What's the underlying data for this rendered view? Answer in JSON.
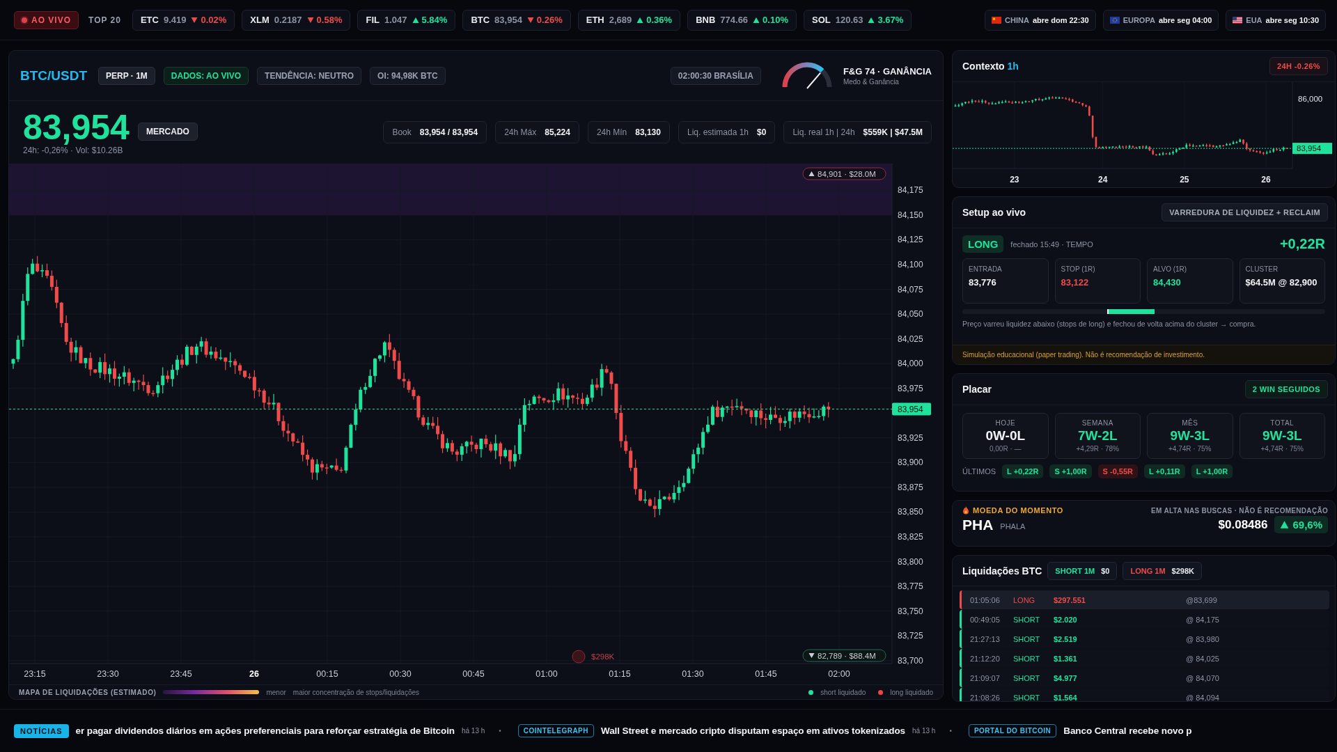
{
  "top_bar": {
    "live_badge": "AO VIVO",
    "list_label": "TOP 20",
    "tickers": [
      {
        "symbol": "ETC",
        "price": "9.419",
        "change": "0.02%",
        "kind": "down"
      },
      {
        "symbol": "XLM",
        "price": "0.2187",
        "change": "0.58%",
        "kind": "down"
      },
      {
        "symbol": "FIL",
        "price": "1.047",
        "change": "5.84%",
        "kind": "up"
      },
      {
        "symbol": "BTC",
        "price": "83,954",
        "change": "0.26%",
        "kind": "down"
      },
      {
        "symbol": "ETH",
        "price": "2,689",
        "change": "0.36%",
        "kind": "up"
      },
      {
        "symbol": "BNB",
        "price": "774.66",
        "change": "0.10%",
        "kind": "up"
      },
      {
        "symbol": "SOL",
        "price": "120.63",
        "change": "3.67%",
        "kind": "up"
      }
    ],
    "markets": [
      {
        "kind": "china",
        "name": "CHINA",
        "status": "abre dom 22:30"
      },
      {
        "kind": "europe",
        "name": "EUROPA",
        "status": "abre seg 04:00"
      },
      {
        "kind": "usa",
        "name": "EUA",
        "status": "abre seg 10:30"
      }
    ]
  },
  "header": {
    "pair": "BTC/USDT",
    "chips": [
      {
        "text": "PERP · 1M",
        "kind": "neutral"
      },
      {
        "text": "DADOS: AO VIVO",
        "kind": "green"
      },
      {
        "text": "TENDÊNCIA: NEUTRO",
        "kind": "muted"
      },
      {
        "text": "OI: 94,98K BTC",
        "kind": "muted"
      }
    ],
    "clock": "02:00:30 BRASÍLIA",
    "fear_greed": {
      "title": "F&G 74 · GANÂNCIA",
      "subtitle": "Medo & Ganância",
      "level": 0.74
    }
  },
  "price": {
    "last": "83,954",
    "badge": "MERCADO",
    "summary": "24h: -0,26% · Vol: $10.26B",
    "stats": [
      {
        "label": "Book",
        "value": "83,954 / 83,954"
      },
      {
        "label": "24h Máx",
        "value": "85,224"
      },
      {
        "label": "24h Mín",
        "value": "83,130"
      },
      {
        "label": "Liq. estimada 1h",
        "value": "$0"
      },
      {
        "label": "Liq. real 1h | 24h",
        "value": "$559K | $47.5M"
      }
    ]
  },
  "chart": {
    "y_ticks_upper": [
      "84,175",
      "84,150",
      "84,125",
      "84,100",
      "84,075",
      "84,050",
      "84,025",
      "84,000",
      "83,975"
    ],
    "y_ticks_lower": [
      "83,925",
      "83,900",
      "83,875",
      "83,850",
      "83,825",
      "83,800",
      "83,775",
      "83,750",
      "83,725",
      "83,700"
    ],
    "price_tag": "83,954",
    "upper_marker": "84,901 · $28.0M",
    "lower_marker": "82,789 · $88.4M",
    "bubble": "$298K",
    "x_ticks": [
      {
        "label": "23:15",
        "emphasis": false
      },
      {
        "label": "23:30",
        "emphasis": false
      },
      {
        "label": "23:45",
        "emphasis": false
      },
      {
        "label": "26",
        "emphasis": true
      },
      {
        "label": "00:15",
        "emphasis": false
      },
      {
        "label": "00:30",
        "emphasis": false
      },
      {
        "label": "00:45",
        "emphasis": false
      },
      {
        "label": "01:00",
        "emphasis": false
      },
      {
        "label": "01:15",
        "emphasis": false
      },
      {
        "label": "01:30",
        "emphasis": false
      },
      {
        "label": "01:45",
        "emphasis": false
      },
      {
        "label": "02:00",
        "emphasis": false
      }
    ],
    "legend": {
      "title": "MAPA DE LIQUIDAÇÕES (ESTIMADO)",
      "scale_low": "menor",
      "scale_text": "maior concentração de stops/liquidações",
      "keys": [
        {
          "label": "short liquidado",
          "color": "#22e39a"
        },
        {
          "label": "long liquidado",
          "color": "#ef4444"
        }
      ]
    }
  },
  "context": {
    "title": "Contexto",
    "timeframe": "1h",
    "badge": "24H -0.26%",
    "y_tick": "86,000",
    "price_tag": "83,954",
    "x_ticks": [
      "23",
      "24",
      "25",
      "26"
    ]
  },
  "setup": {
    "title": "Setup ao vivo",
    "tag": "VARREDURA DE LIQUIDEZ + RECLAIM",
    "side": "LONG",
    "status": "fechado 15:49 · TEMPO",
    "result": "+0,22R",
    "boxes": [
      {
        "label": "ENTRADA",
        "value": "83,776",
        "kind": "neutral"
      },
      {
        "label": "STOP (1R)",
        "value": "83,122",
        "kind": "red"
      },
      {
        "label": "ALVO (1R)",
        "value": "84,430",
        "kind": "green"
      },
      {
        "label": "CLUSTER",
        "value": "$64.5M @ 82,900",
        "kind": "neutral"
      }
    ],
    "note": "Preço varreu liquidez abaixo (stops de long) e fechou de volta acima do cluster → compra.",
    "disclaimer": "Simulação educacional (paper trading). Não é recomendação de investimento."
  },
  "scoreboard": {
    "title": "Placar",
    "streak": "2 WIN SEGUIDOS",
    "periods": [
      {
        "label": "HOJE",
        "record": "0W-0L",
        "detail": "0,00R · —",
        "kind": "neutral"
      },
      {
        "label": "SEMANA",
        "record": "7W-2L",
        "detail": "+4,29R · 78%",
        "kind": "green"
      },
      {
        "label": "MÊS",
        "record": "9W-3L",
        "detail": "+4,74R · 75%",
        "kind": "green"
      },
      {
        "label": "TOTAL",
        "record": "9W-3L",
        "detail": "+4,74R · 75%",
        "kind": "green"
      }
    ],
    "recent_label": "ÚLTIMOS",
    "recent": [
      {
        "text": "L +0,22R",
        "kind": "win"
      },
      {
        "text": "S +1,00R",
        "kind": "win"
      },
      {
        "text": "S -0,55R",
        "kind": "loss"
      },
      {
        "text": "L +0,11R",
        "kind": "win"
      },
      {
        "text": "L +1,00R",
        "kind": "win"
      }
    ]
  },
  "trending": {
    "title": "MOEDA DO MOMENTO",
    "note": "EM ALTA NAS BUSCAS · NÃO É RECOMENDAÇÃO",
    "symbol": "PHA",
    "name": "PHALA",
    "price": "$0.08486",
    "change": "69,6%",
    "kind": "up"
  },
  "liquidations": {
    "title": "Liquidações BTC",
    "chips": [
      {
        "label": "SHORT 1M",
        "value": "$0",
        "kind": "short"
      },
      {
        "label": "LONG 1M",
        "value": "$298K",
        "kind": "long"
      }
    ],
    "rows": [
      {
        "time": "01:05:06",
        "kind": "long",
        "side_label": "LONG",
        "amount": "$297.551",
        "price": "@83,699",
        "selected": true
      },
      {
        "time": "00:49:05",
        "kind": "short",
        "side_label": "SHORT",
        "amount": "$2.020",
        "price": "@ 84,175",
        "selected": false
      },
      {
        "time": "21:27:13",
        "kind": "short",
        "side_label": "SHORT",
        "amount": "$2.519",
        "price": "@ 83,980",
        "selected": false
      },
      {
        "time": "21:12:20",
        "kind": "short",
        "side_label": "SHORT",
        "amount": "$1.361",
        "price": "@ 84,025",
        "selected": false
      },
      {
        "time": "21:09:07",
        "kind": "short",
        "side_label": "SHORT",
        "amount": "$4.977",
        "price": "@ 84,070",
        "selected": false
      },
      {
        "time": "21:08:26",
        "kind": "short",
        "side_label": "SHORT",
        "amount": "$1.564",
        "price": "@ 84,094",
        "selected": false
      }
    ]
  },
  "news": {
    "label": "NOTÍCIAS",
    "separator": "•",
    "items": [
      {
        "headline": "er pagar dividendos diários em ações preferenciais para reforçar estratégia de Bitcoin",
        "age": "há 13 h"
      },
      {
        "source": "COINTELEGRAPH",
        "headline": "Wall Street e mercado cripto disputam espaço em ativos tokenizados",
        "age": "há 13 h"
      },
      {
        "source": "PORTAL DO BITCOIN",
        "headline": "Banco Central recebe novo p"
      }
    ]
  }
}
